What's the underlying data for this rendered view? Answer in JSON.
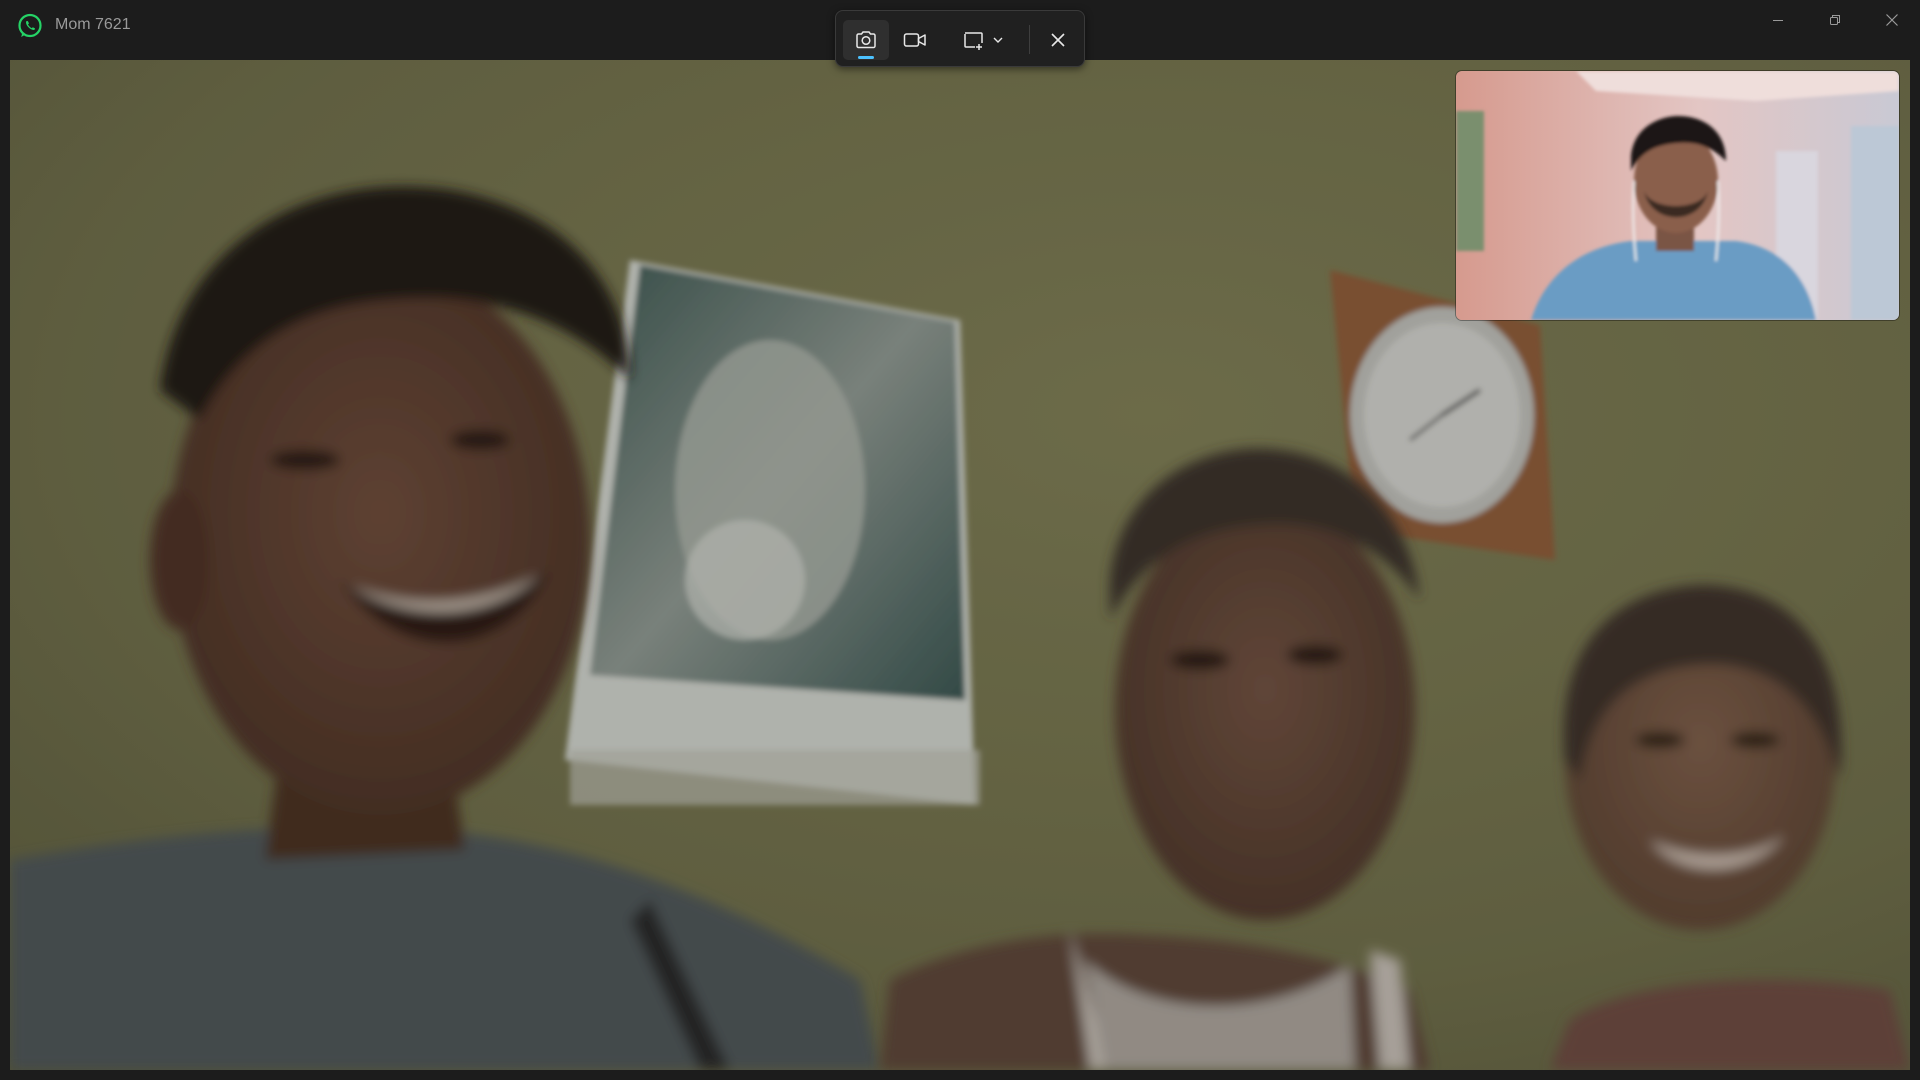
{
  "window": {
    "title": "Mom 7621",
    "app_icon": "whatsapp-icon",
    "controls": [
      "minimize-icon",
      "restore-icon",
      "close-icon"
    ]
  },
  "capture_toolbar": {
    "buttons": [
      {
        "icon": "camera-icon",
        "selected": true
      },
      {
        "icon": "video-camera-icon",
        "selected": false
      },
      {
        "icon": "capture-region-icon",
        "dropdown_icon": "chevron-down-icon",
        "selected": false
      },
      {
        "icon": "close-icon",
        "selected": false
      }
    ],
    "accent": "#4cc2ff"
  },
  "main_video": {
    "content": "remote-video-feed"
  },
  "self_view": {
    "content": "local-camera-preview"
  },
  "colors": {
    "titlebar_bg": "#1c1c1c",
    "title_text": "#9a9a9a",
    "whatsapp_green": "#25d366",
    "toolbar_bg": "#202020",
    "wall": "#6e6d4a"
  }
}
